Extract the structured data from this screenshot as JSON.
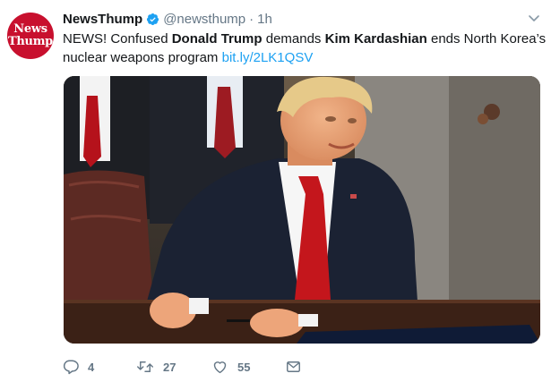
{
  "tweet": {
    "avatar_lines": [
      "News",
      "Thump"
    ],
    "name": "NewsThump",
    "handle": "@newsthump",
    "separator": "·",
    "time": "1h",
    "text_parts": {
      "p1": "NEWS! Confused ",
      "b1": "Donald Trump",
      "p2": " demands ",
      "b2": "Kim Kardashian",
      "p3": " ends North Korea’s nuclear weapons program ",
      "link": "bit.ly/2LK1QSV"
    },
    "actions": {
      "reply_count": "4",
      "retweet_count": "27",
      "like_count": "55"
    }
  },
  "colors": {
    "brand_red": "#c8102e",
    "twitter_blue": "#1da1f2",
    "meta_gray": "#657786"
  },
  "icons": [
    "verified-badge-icon",
    "chevron-down-icon",
    "reply-icon",
    "retweet-icon",
    "like-icon",
    "message-icon"
  ]
}
